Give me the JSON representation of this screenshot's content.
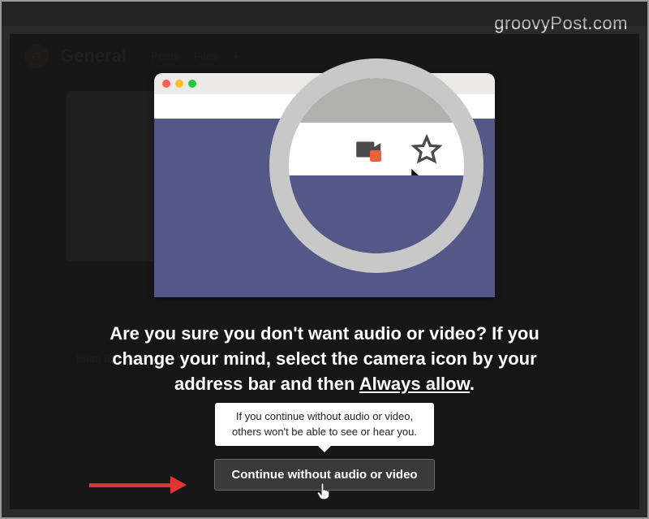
{
  "watermark": "groovyPost.com",
  "background": {
    "channel_title": "General",
    "tabs": [
      "Posts",
      "Files",
      "+"
    ],
    "avatar_initial": "G",
    "poster": "Brian Burgess"
  },
  "illustration": {
    "camera_icon": "camera-icon",
    "camera_blocked_badge_color": "#e8633a",
    "star_icon": "star-icon",
    "traffic_lights": [
      "red",
      "yellow",
      "green"
    ]
  },
  "prompt": {
    "line1": "Are you sure you don't want audio or video? If you",
    "line2": "change your mind, select the camera icon by your",
    "line3_prefix": "address bar and then ",
    "line3_underlined": "Always allow",
    "line3_suffix": "."
  },
  "tooltip": {
    "line1": "If you continue without audio or video,",
    "line2": "others won't be able to see or hear you."
  },
  "button": {
    "continue_label": "Continue without audio or video"
  }
}
